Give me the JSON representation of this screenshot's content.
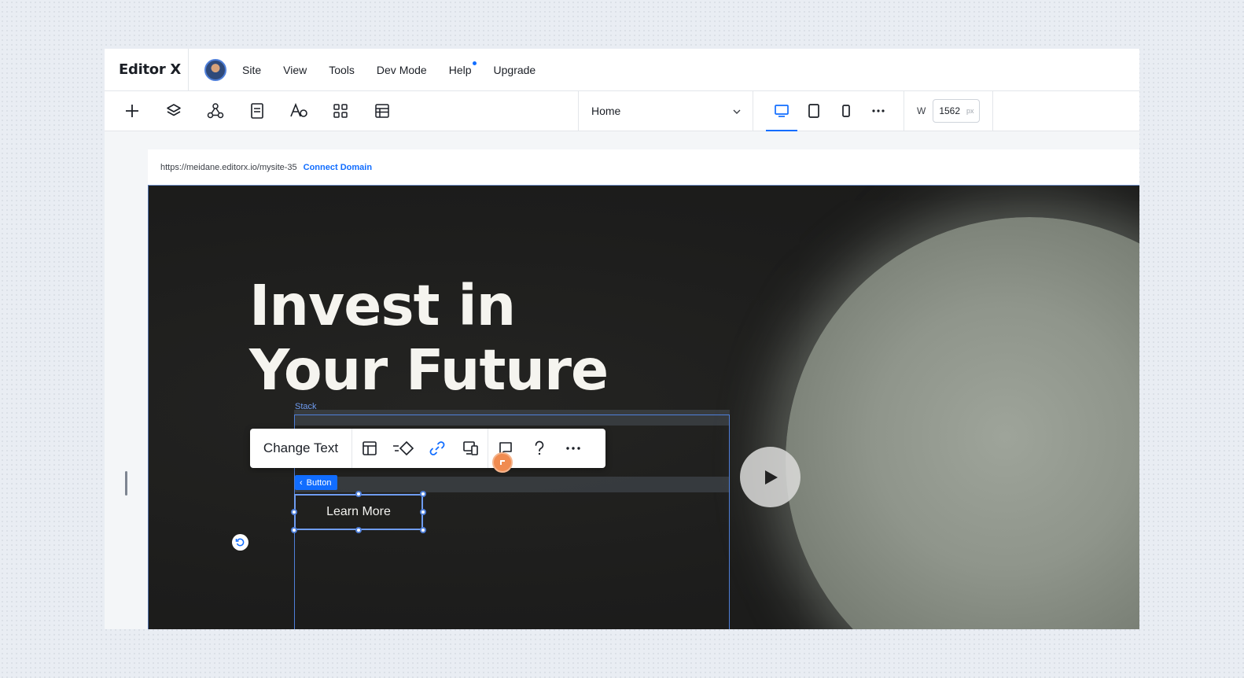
{
  "brand": "Editor X",
  "menu": [
    {
      "label": "Site"
    },
    {
      "label": "View"
    },
    {
      "label": "Tools"
    },
    {
      "label": "Dev Mode"
    },
    {
      "label": "Help"
    },
    {
      "label": "Upgrade"
    }
  ],
  "toolbar": {
    "tools": [
      "add-icon",
      "layers-icon",
      "connections-icon",
      "pages-icon",
      "typography-icon",
      "apps-grid-icon",
      "table-icon"
    ],
    "page_select": "Home",
    "width_label": "W",
    "width_value": "1562",
    "width_unit": "px"
  },
  "url": {
    "address": "https://meidane.editorx.io/mysite-35",
    "connect": "Connect Domain"
  },
  "canvas": {
    "stack_label": "Stack",
    "heading_line1": "Invest in",
    "heading_line2": "Your Future",
    "button_tag": "Button",
    "button_text": "Learn More"
  },
  "actionbar": {
    "change_text": "Change Text"
  },
  "colors": {
    "accent": "#116dff",
    "selection": "#4f7fd9",
    "hero_bg": "#1d1d1c"
  }
}
